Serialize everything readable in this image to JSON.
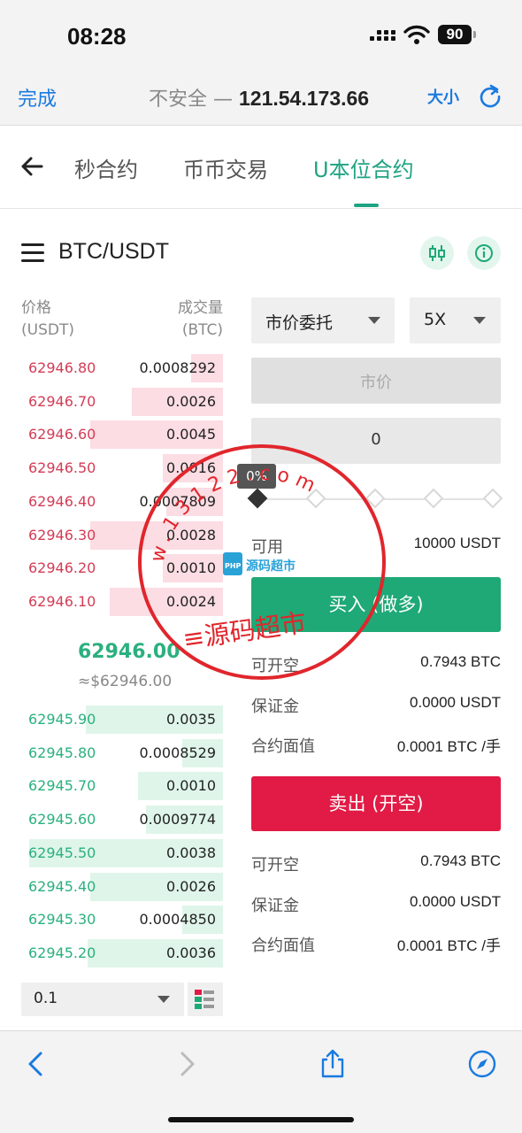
{
  "status_bar": {
    "time": "08:28",
    "battery": "90"
  },
  "browser": {
    "done": "完成",
    "security": "不安全 — ",
    "url": "121.54.173.66",
    "text_size": "大小"
  },
  "tabs": [
    {
      "label": "秒合约",
      "active": false
    },
    {
      "label": "币币交易",
      "active": false
    },
    {
      "label": "U本位合约",
      "active": true
    }
  ],
  "pair": {
    "title": "BTC/USDT"
  },
  "order_book": {
    "price_header": [
      "价格",
      "(USDT)"
    ],
    "qty_header": [
      "成交量",
      "(BTC)"
    ],
    "sell": [
      {
        "price": "62946.80",
        "qty": "0.0008292",
        "depth": 0.16
      },
      {
        "price": "62946.70",
        "qty": "0.0026",
        "depth": 0.45
      },
      {
        "price": "62946.60",
        "qty": "0.0045",
        "depth": 0.66
      },
      {
        "price": "62946.50",
        "qty": "0.0016",
        "depth": 0.3
      },
      {
        "price": "62946.40",
        "qty": "0.0007809",
        "depth": 0.28
      },
      {
        "price": "62946.30",
        "qty": "0.0028",
        "depth": 0.66
      },
      {
        "price": "62946.20",
        "qty": "0.0010",
        "depth": 0.3
      },
      {
        "price": "62946.10",
        "qty": "0.0024",
        "depth": 0.56
      }
    ],
    "last_price": "62946.00",
    "last_fiat": "≈$62946.00",
    "buy": [
      {
        "price": "62945.90",
        "qty": "0.0035",
        "depth": 0.68
      },
      {
        "price": "62945.80",
        "qty": "0.0008529",
        "depth": 0.2
      },
      {
        "price": "62945.70",
        "qty": "0.0010",
        "depth": 0.42
      },
      {
        "price": "62945.60",
        "qty": "0.0009774",
        "depth": 0.38
      },
      {
        "price": "62945.50",
        "qty": "0.0038",
        "depth": 0.96
      },
      {
        "price": "62945.40",
        "qty": "0.0026",
        "depth": 0.66
      },
      {
        "price": "62945.30",
        "qty": "0.0004850",
        "depth": 0.2
      },
      {
        "price": "62945.20",
        "qty": "0.0036",
        "depth": 0.67
      }
    ],
    "depth_step": "0.1"
  },
  "trade": {
    "order_type": "市价委托",
    "leverage": "5X",
    "price_placeholder": "市价",
    "amount": "0",
    "slider_percent": "0%",
    "available_label": "可用",
    "available_value": "10000 USDT",
    "buy_button": "买入 (做多)",
    "buy_info": [
      {
        "label": "可开空",
        "value": "0.7943 BTC"
      },
      {
        "label": "保证金",
        "value": "0.0000 USDT"
      },
      {
        "label": "合约面值",
        "value": "0.0001 BTC /手"
      }
    ],
    "sell_button": "卖出 (开空)",
    "sell_info": [
      {
        "label": "可开空",
        "value": "0.7943 BTC"
      },
      {
        "label": "保证金",
        "value": "0.0000 USDT"
      },
      {
        "label": "合约面值",
        "value": "0.0001 BTC /手"
      }
    ]
  },
  "watermark": {
    "ring_text": "w.13122.com",
    "center_text": "源码超市",
    "bottom_text": "≡源码超市"
  },
  "colors": {
    "accent": "#1fa383",
    "buy": "#1ea976",
    "sell": "#e11b45",
    "stamp": "#e0262c"
  }
}
